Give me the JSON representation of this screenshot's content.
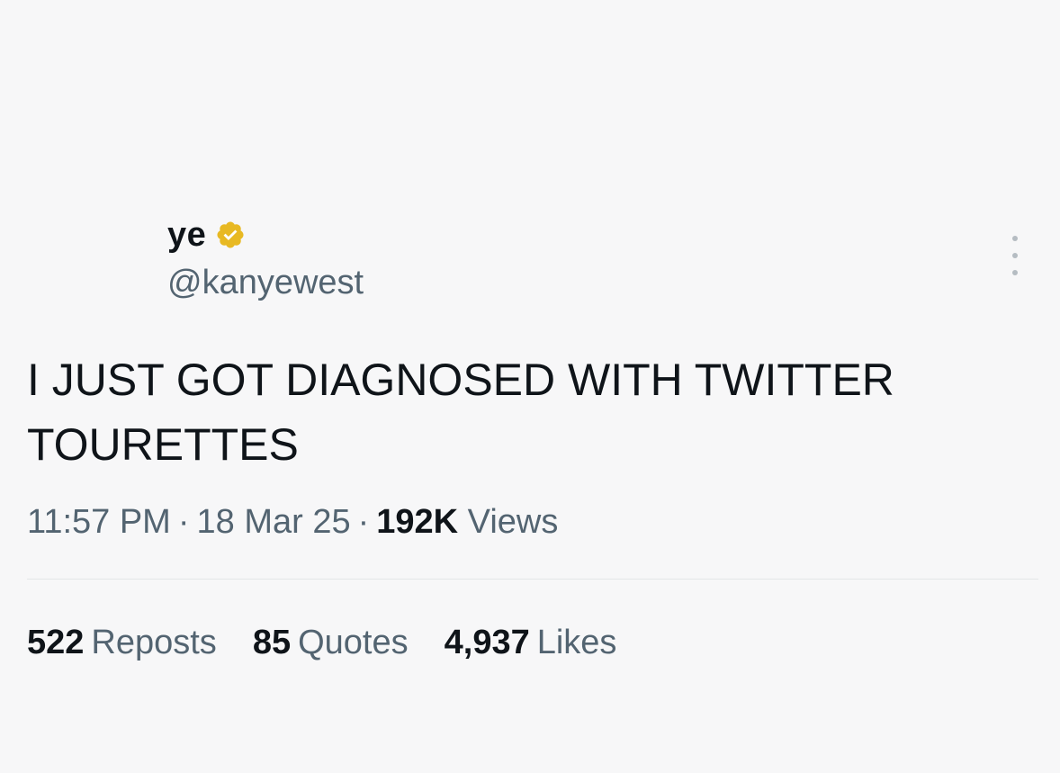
{
  "tweet": {
    "author": {
      "display_name": "ye",
      "handle": "@kanyewest",
      "verified": true,
      "verified_color": "#e8b923",
      "verified_icon": "verified-badge-icon"
    },
    "more_icon": "more-options-icon",
    "text_line1": "I JUST GOT DIAGNOSED WITH TWITTER",
    "text_line2": "TOURETTES",
    "time": "11:57 PM",
    "separator": "·",
    "date": "18 Mar 25",
    "views_count": "192K",
    "views_label": "Views",
    "stats": {
      "reposts_count": "522",
      "reposts_label": "Reposts",
      "quotes_count": "85",
      "quotes_label": "Quotes",
      "likes_count": "4,937",
      "likes_label": "Likes"
    }
  }
}
